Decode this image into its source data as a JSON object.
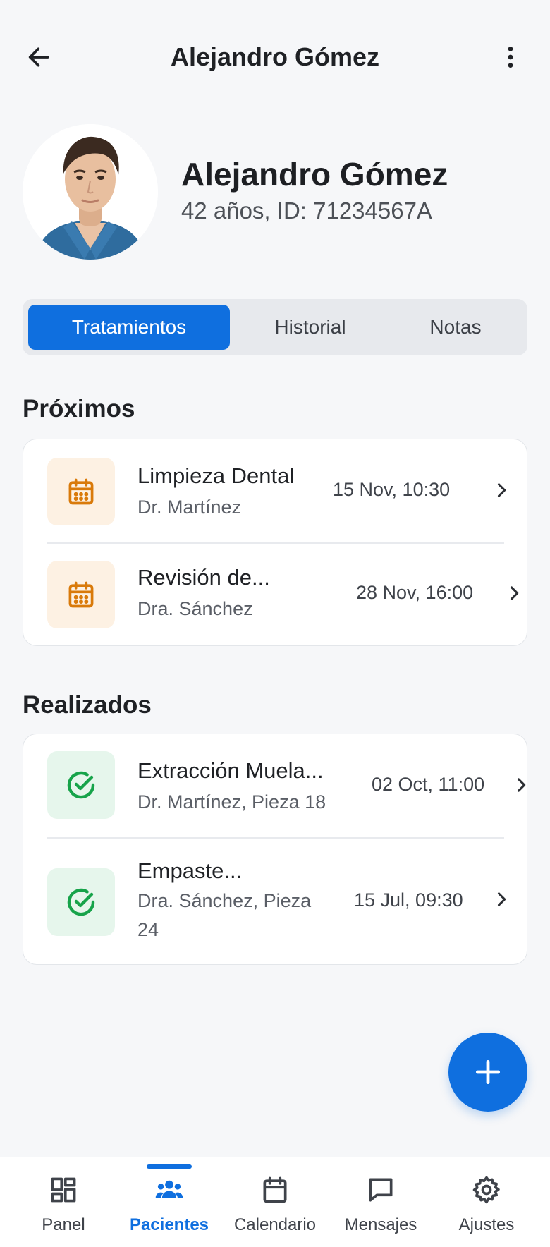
{
  "header": {
    "title": "Alejandro Gómez",
    "back_icon": "arrow-left-icon",
    "menu_icon": "more-vertical-icon"
  },
  "patient": {
    "name": "Alejandro Gómez",
    "meta": "42 años, ID: 71234567A"
  },
  "tabs": [
    {
      "label": "Tratamientos",
      "active": true
    },
    {
      "label": "Historial",
      "active": false
    },
    {
      "label": "Notas",
      "active": false
    }
  ],
  "upcoming": {
    "title": "Próximos",
    "items": [
      {
        "title": "Limpieza Dental",
        "subtitle": "Dr. Martínez",
        "date": "15 Nov, 10:30",
        "icon": "calendar-icon"
      },
      {
        "title": "Revisión de...",
        "subtitle": "Dra. Sánchez",
        "date": "28 Nov, 16:00",
        "icon": "calendar-icon"
      }
    ]
  },
  "completed": {
    "title": "Realizados",
    "items": [
      {
        "title": "Extracción Muela...",
        "subtitle": "Dr. Martínez, Pieza 18",
        "date": "02 Oct, 11:00",
        "icon": "check-circle-icon"
      },
      {
        "title": "Empaste...",
        "subtitle": "Dra. Sánchez, Pieza 24",
        "date": "15 Jul, 09:30",
        "icon": "check-circle-icon"
      }
    ]
  },
  "fab": {
    "icon": "plus-icon"
  },
  "nav": [
    {
      "label": "Panel",
      "icon": "dashboard-icon",
      "active": false
    },
    {
      "label": "Pacientes",
      "icon": "patients-icon",
      "active": true
    },
    {
      "label": "Calendario",
      "icon": "calendar-icon",
      "active": false
    },
    {
      "label": "Mensajes",
      "icon": "message-icon",
      "active": false
    },
    {
      "label": "Ajustes",
      "icon": "settings-icon",
      "active": false
    }
  ],
  "colors": {
    "accent": "#0f6fdf",
    "upcoming_icon": "#d97a0a",
    "done_icon": "#17a34a"
  }
}
